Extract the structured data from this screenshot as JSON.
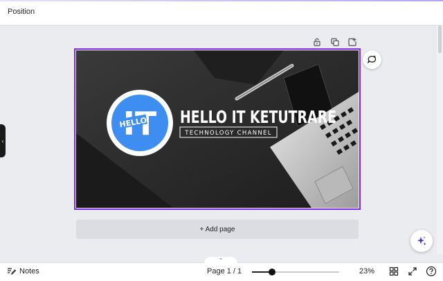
{
  "header": {
    "title": "Position"
  },
  "page_toolbar": {
    "icons": [
      "lock-icon",
      "duplicate-icon",
      "add-page-icon"
    ]
  },
  "design": {
    "logo_text_top": "IT",
    "logo_text_badge": "HELLO",
    "headline": "HELLO IT KETUTRARE",
    "subheadline": "TECHNOLOGY CHANNEL"
  },
  "add_page": {
    "label": "+ Add page"
  },
  "footer": {
    "notes_label": "Notes",
    "page_indicator": "Page 1 / 1",
    "zoom_label": "23%",
    "zoom_fraction": 0.23
  },
  "colors": {
    "selection": "#7d2ae8",
    "logo_blue": "#3d8ef0",
    "photo_dark": "#262626"
  }
}
